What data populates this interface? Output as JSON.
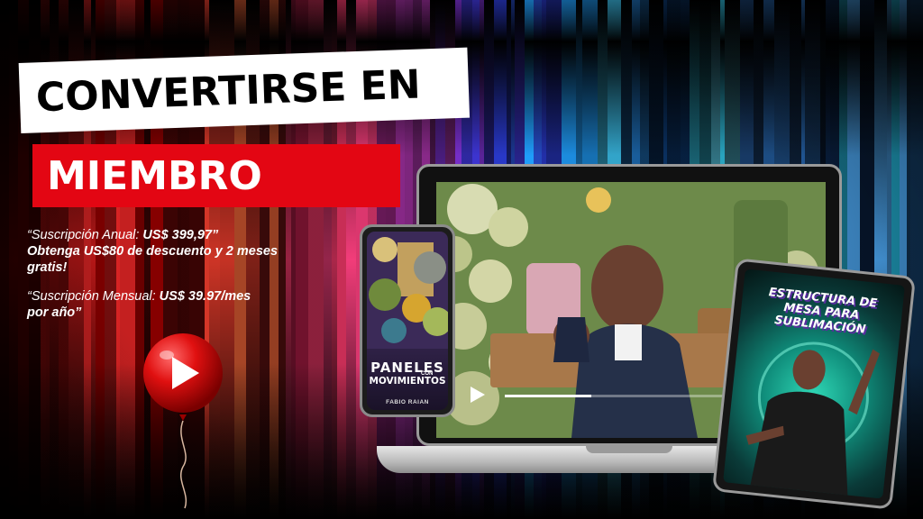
{
  "headline": {
    "line1": "CONVERTIRSE EN",
    "line2": "MIEMBRO"
  },
  "promo": {
    "annual_prefix": "“Suscripción Anual: ",
    "annual_price": "US$ 399,97”",
    "annual_offer": "Obtenga US$80 de descuento y 2 meses gratis!",
    "monthly_prefix": "“Suscripción Mensual: ",
    "monthly_price": "US$ 39.97/mes",
    "monthly_suffix": "por año”"
  },
  "phone_cover": {
    "title": "PANELES",
    "connector": "CON",
    "subtitle": "MOVIMIENTOS",
    "author": "FABIO RAIAN"
  },
  "tablet_cover": {
    "title": "ESTRUCTURA DE MESA PARA SUBLIMACIÓN"
  },
  "video": {
    "progress": 0.3
  },
  "colors": {
    "accent_red": "#e30613",
    "headline_bg": "#ffffff",
    "tablet_glow": "#2fd7b5",
    "phone_cover_bg": "#3b2a58"
  },
  "icons": {
    "balloon": "play-balloon-icon",
    "video_play": "play-icon"
  }
}
